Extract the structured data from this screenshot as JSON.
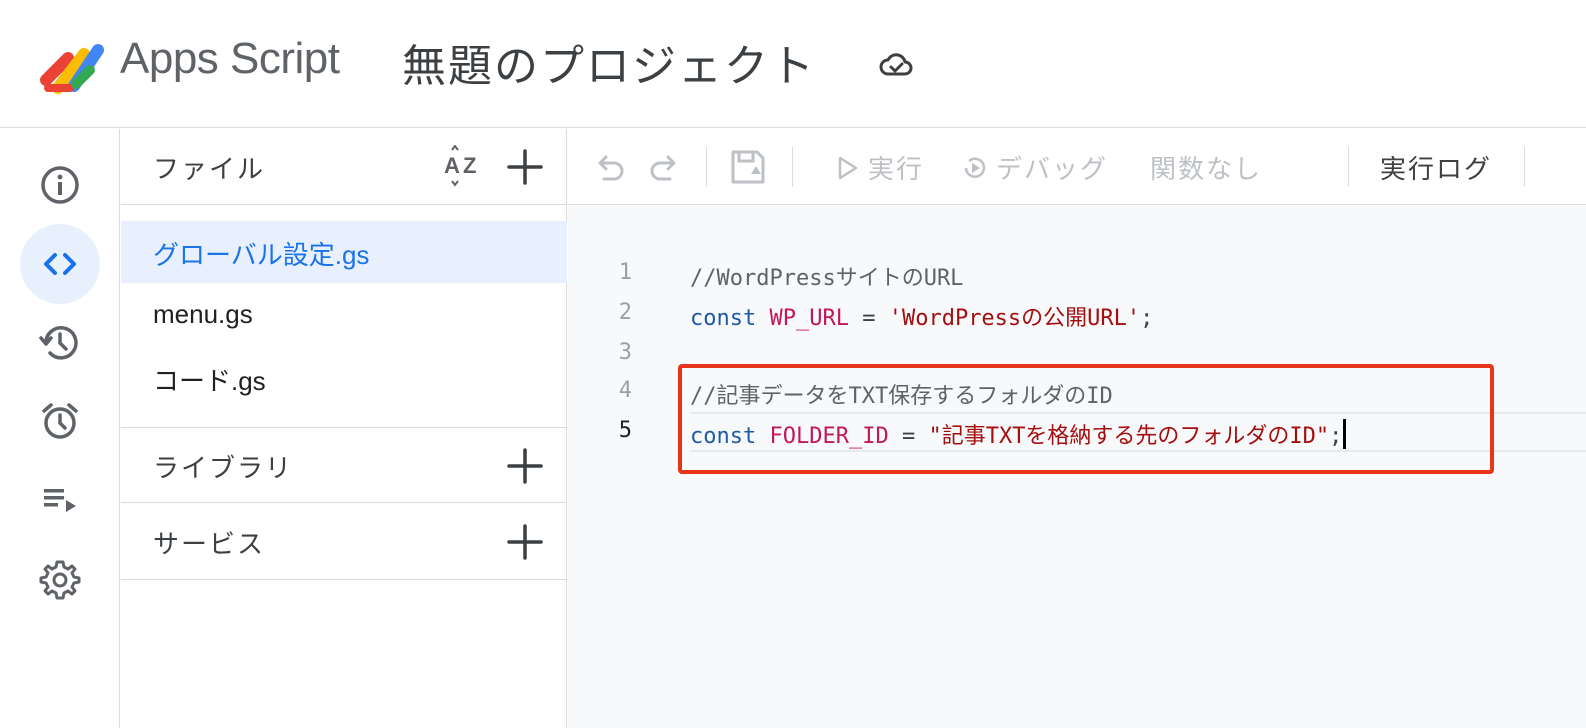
{
  "header": {
    "app_name": "Apps Script",
    "project_title": "無題のプロジェクト",
    "cloud_icon": "cloud-saved-icon"
  },
  "rail": {
    "items": [
      {
        "icon": "info-icon",
        "active": false
      },
      {
        "icon": "code-icon",
        "active": true
      },
      {
        "icon": "history-icon",
        "active": false
      },
      {
        "icon": "alarm-icon",
        "active": false
      },
      {
        "icon": "executions-icon",
        "active": false
      },
      {
        "icon": "gear-icon",
        "active": false
      }
    ]
  },
  "files_panel": {
    "files_label": "ファイル",
    "files": [
      {
        "name": "グローバル設定.gs",
        "selected": true
      },
      {
        "name": "menu.gs",
        "selected": false
      },
      {
        "name": "コード.gs",
        "selected": false
      }
    ],
    "libraries_label": "ライブラリ",
    "services_label": "サービス"
  },
  "toolbar": {
    "run_label": "実行",
    "debug_label": "デバッグ",
    "function_label": "関数なし",
    "log_label": "実行ログ"
  },
  "editor": {
    "lines": [
      {
        "num": "1",
        "text": "//WordPressサイトのURL"
      },
      {
        "num": "2",
        "kw": "const",
        "var": "WP_URL",
        "op": " = ",
        "str": "'WordPressの公開URL'",
        "end": ";"
      },
      {
        "num": "3",
        "text": ""
      },
      {
        "num": "4",
        "text": "//記事データをTXT保存するフォルダのID"
      },
      {
        "num": "5",
        "kw": "const",
        "var": "FOLDER_ID",
        "op": " = ",
        "str": "\"記事TXTを格納する先のフォルダのID\"",
        "end": ";"
      }
    ],
    "current_line": "5",
    "highlight_color": "#e8341a"
  }
}
